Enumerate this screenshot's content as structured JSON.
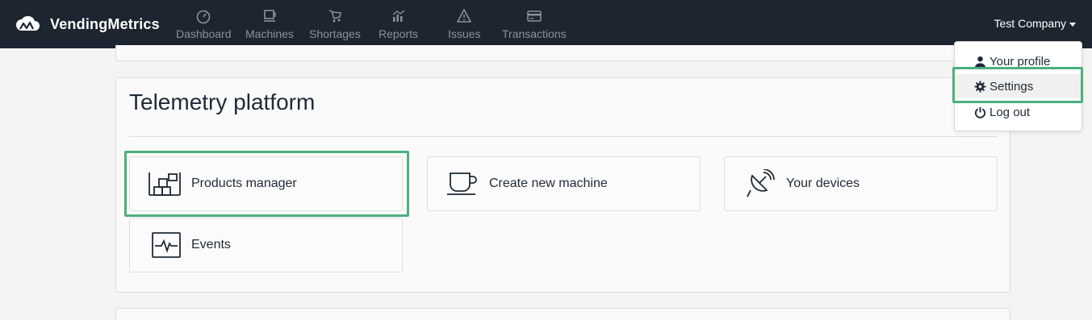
{
  "app": {
    "name": "VendingMetrics"
  },
  "nav": {
    "items": [
      {
        "label": "Dashboard",
        "icon": "gauge-icon"
      },
      {
        "label": "Machines",
        "icon": "coffee-machine-icon"
      },
      {
        "label": "Shortages",
        "icon": "cart-icon"
      },
      {
        "label": "Reports",
        "icon": "chart-icon"
      },
      {
        "label": "Issues",
        "icon": "warning-icon"
      },
      {
        "label": "Transactions",
        "icon": "credit-card-icon"
      }
    ],
    "account_label": "Test Company"
  },
  "dropdown": {
    "items": [
      {
        "label": "Your profile",
        "icon": "user-icon"
      },
      {
        "label": "Settings",
        "icon": "gear-icon"
      },
      {
        "label": "Log out",
        "icon": "power-icon"
      }
    ]
  },
  "panel": {
    "title": "Telemetry platform",
    "tiles": [
      {
        "label": "Products manager",
        "icon": "shelves-icon"
      },
      {
        "label": "Create new machine",
        "icon": "cup-icon"
      },
      {
        "label": "Your devices",
        "icon": "satellite-dish-icon"
      },
      {
        "label": "Events",
        "icon": "pulse-icon"
      }
    ]
  },
  "colors": {
    "navbar": "#1c2530",
    "highlight": "#4caf7d",
    "nav_text": "#8a939c"
  }
}
